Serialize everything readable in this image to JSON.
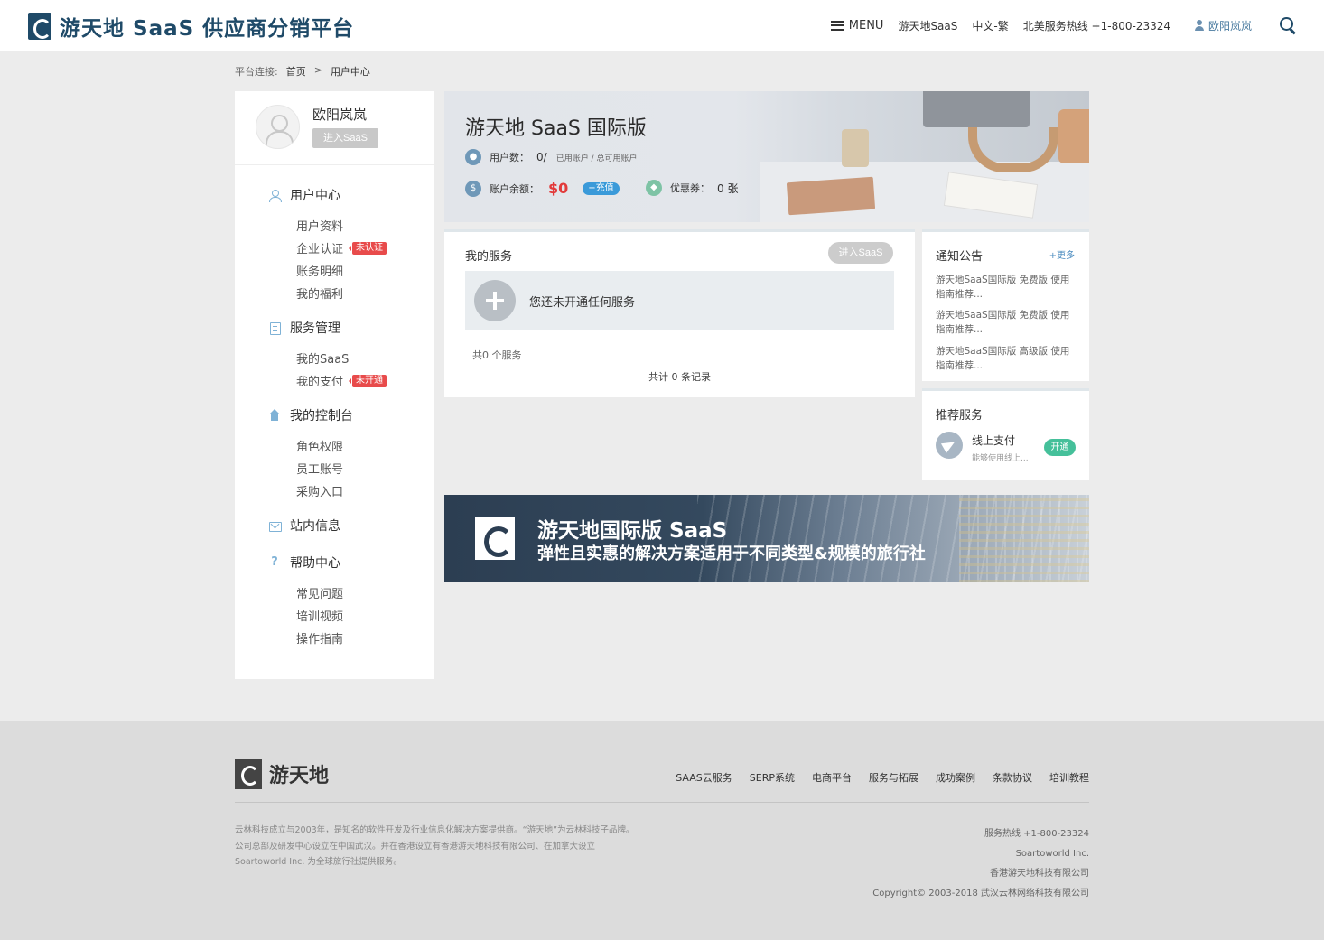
{
  "header": {
    "brand": "游天地 SaaS 供应商分销平台",
    "menu_label": "MENU",
    "nav_saas": "游天地SaaS",
    "language": "中文-繁",
    "hotline": "北美服务热线 +1-800-23324",
    "user_name": "欧阳岚岚"
  },
  "breadcrumb": {
    "prefix": "平台连接:",
    "home": "首页",
    "separator": ">",
    "current": "用户中心"
  },
  "profile": {
    "name": "欧阳岚岚",
    "enter_button": "进入SaaS"
  },
  "sidebar": {
    "user_center": {
      "title": "用户中心",
      "items": [
        "用户资料",
        "企业认证",
        "账务明细",
        "我的福利"
      ],
      "tag": "未认证"
    },
    "service_mgmt": {
      "title": "服务管理",
      "items": [
        "我的SaaS",
        "我的支付"
      ],
      "tag": "未开通"
    },
    "console": {
      "title": "我的控制台",
      "items": [
        "角色权限",
        "员工账号",
        "采购入口"
      ]
    },
    "messages": {
      "title": "站内信息"
    },
    "help": {
      "title": "帮助中心",
      "items": [
        "常见问题",
        "培训视频",
        "操作指南"
      ]
    }
  },
  "hero": {
    "title": "游天地 SaaS 国际版",
    "users_label": "用户数：",
    "users_value": "0/",
    "users_note": "已用账户 / 总可用账户",
    "balance_label": "账户余额：",
    "balance_value": "$0",
    "recharge": "+充值",
    "coupon_label": "优惠券：",
    "coupon_value": "0 张"
  },
  "services": {
    "title": "我的服务",
    "enter_button": "进入SaaS",
    "empty_text": "您还未开通任何服务",
    "count": "共0 个服务",
    "total": "共计 0 条记录"
  },
  "notices": {
    "title": "通知公告",
    "more": "+更多",
    "items": [
      "游天地SaaS国际版 免费版 使用指南推荐...",
      "游天地SaaS国际版 免费版 使用指南推荐...",
      "游天地SaaS国际版 高级版 使用指南推荐..."
    ]
  },
  "recommend": {
    "title": "推荐服务",
    "name": "线上支付",
    "desc": "能够使用线上...",
    "button": "开通"
  },
  "banner": {
    "title": "游天地国际版 SaaS",
    "subtitle": "弹性且实惠的解决方案适用于不同类型&规模的旅行社"
  },
  "footer": {
    "logo_text": "游天地",
    "nav": [
      "SAAS云服务",
      "SERP系统",
      "电商平台",
      "服务与拓展",
      "成功案例",
      "条款协议",
      "培训教程"
    ],
    "about": [
      "云林科技成立与2003年，是知名的软件开发及行业信息化解决方案提供商。“游天地”为云林科技子品牌。",
      "公司总部及研发中心设立在中国武汉。并在香港设立有香港游天地科技有限公司、在加拿大设立",
      "Soartoworld Inc. 为全球旅行社提供服务。"
    ],
    "contact": [
      "服务热线 +1-800-23324",
      "Soartoworld Inc.",
      "香港游天地科技有限公司",
      "Copyright© 2003-2018 武汉云林网络科技有限公司"
    ]
  }
}
